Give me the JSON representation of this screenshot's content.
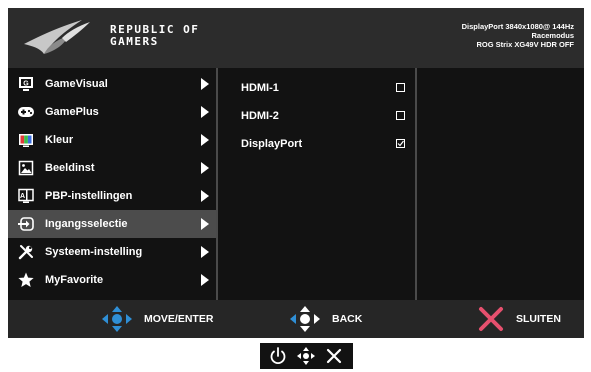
{
  "brand": {
    "line1": "REPUBLIC OF",
    "line2": "GAMERS",
    "logo_icon": "rog-eye-logo-icon"
  },
  "status": {
    "signal": "DisplayPort 3840x1080@ 144Hz",
    "mode": "Racemodus",
    "model": "ROG Strix XG49V HDR OFF"
  },
  "menu": {
    "items": [
      {
        "label": "GameVisual",
        "icon": "gamevisual-icon",
        "active": false
      },
      {
        "label": "GamePlus",
        "icon": "gamepad-icon",
        "active": false
      },
      {
        "label": "Kleur",
        "icon": "color-icon",
        "active": false
      },
      {
        "label": "Beeldinst",
        "icon": "image-icon",
        "active": false
      },
      {
        "label": "PBP-instellingen",
        "icon": "pbp-icon",
        "active": false
      },
      {
        "label": "Ingangsselectie",
        "icon": "input-icon",
        "active": true
      },
      {
        "label": "Systeem-instelling",
        "icon": "tools-icon",
        "active": false
      },
      {
        "label": "MyFavorite",
        "icon": "star-icon",
        "active": false
      }
    ]
  },
  "submenu": {
    "items": [
      {
        "label": "HDMI-1",
        "checked": false
      },
      {
        "label": "HDMI-2",
        "checked": false
      },
      {
        "label": "DisplayPort",
        "checked": true
      }
    ]
  },
  "footer": {
    "move_label": "MOVE/ENTER",
    "back_label": "BACK",
    "exit_label": "SLUITEN",
    "accent": "#2f8fd6",
    "exit_color": "#e6506e"
  },
  "keys": [
    "power-icon",
    "joystick-icon",
    "close-icon"
  ]
}
